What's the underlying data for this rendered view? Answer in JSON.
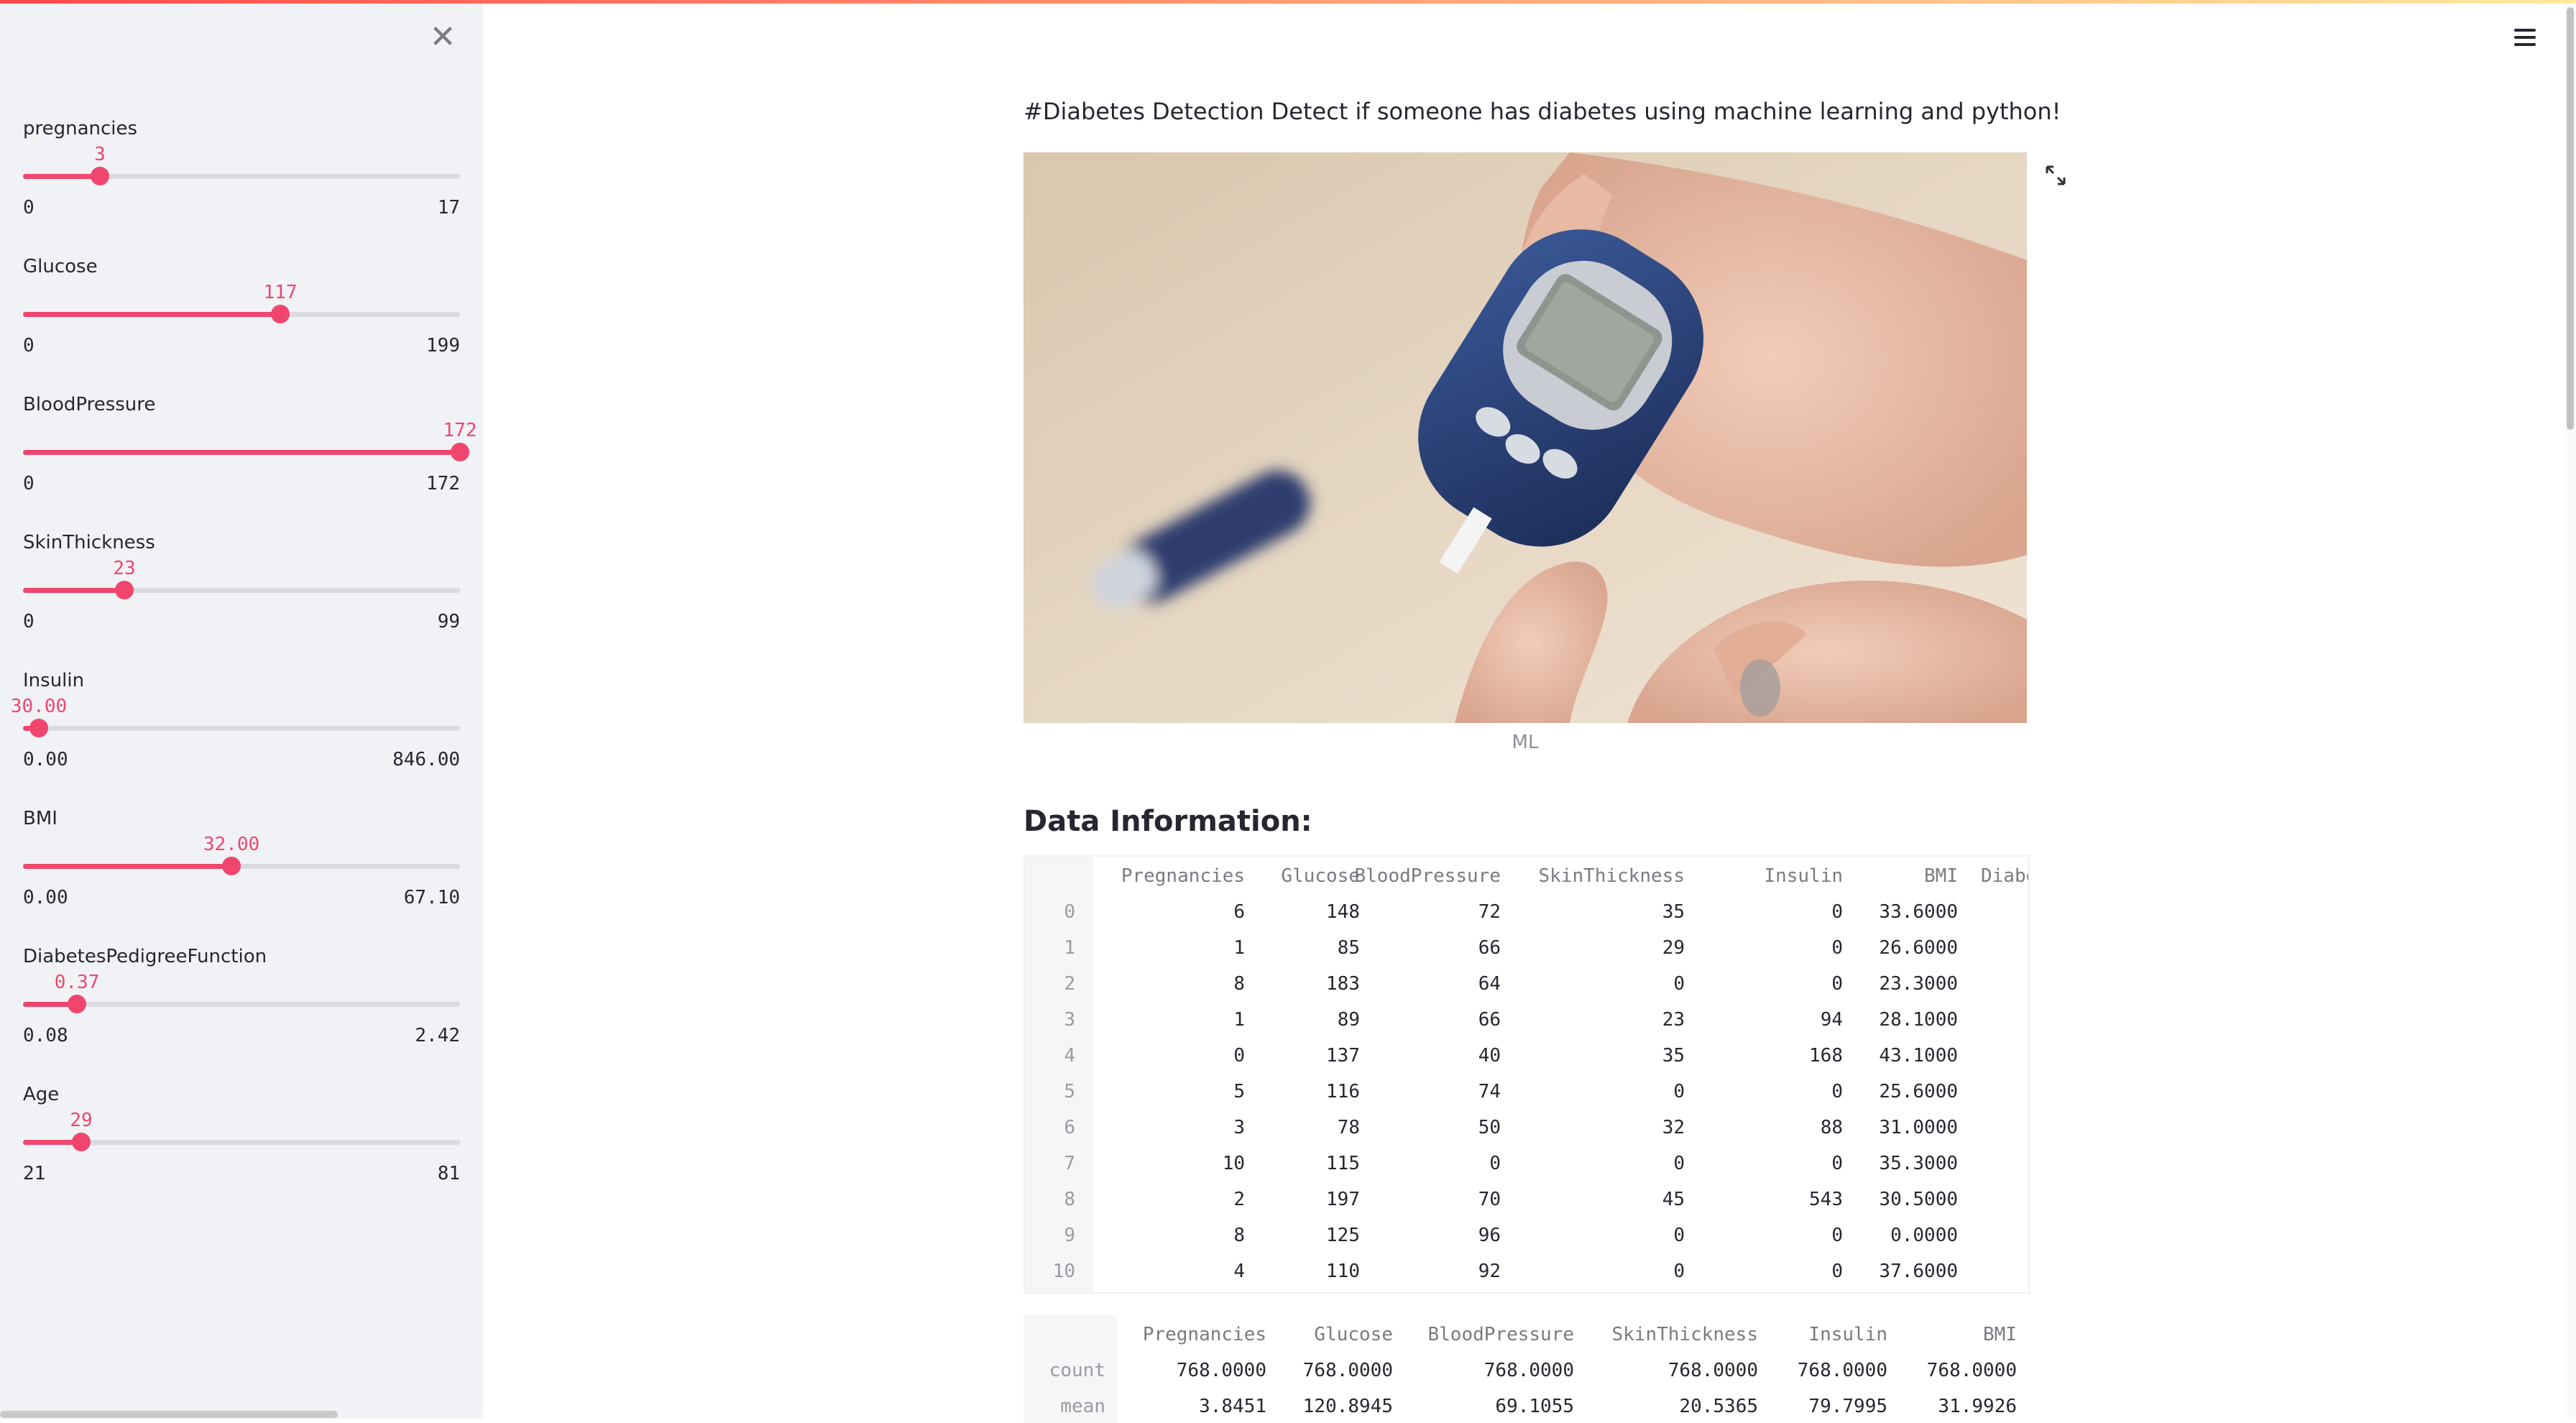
{
  "sidebar": {
    "close_icon": "close-icon",
    "sliders": [
      {
        "label": "pregnancies",
        "value": "3",
        "min": "0",
        "max": "17",
        "fraction": 0.1765
      },
      {
        "label": "Glucose",
        "value": "117",
        "min": "0",
        "max": "199",
        "fraction": 0.588
      },
      {
        "label": "BloodPressure",
        "value": "172",
        "min": "0",
        "max": "172",
        "fraction": 1.0
      },
      {
        "label": "SkinThickness",
        "value": "23",
        "min": "0",
        "max": "99",
        "fraction": 0.2323
      },
      {
        "label": "Insulin",
        "value": "30.00",
        "min": "0.00",
        "max": "846.00",
        "fraction": 0.0355
      },
      {
        "label": "BMI",
        "value": "32.00",
        "min": "0.00",
        "max": "67.10",
        "fraction": 0.4769
      },
      {
        "label": "DiabetesPedigreeFunction",
        "value": "0.37",
        "min": "0.08",
        "max": "2.42",
        "fraction": 0.1239
      },
      {
        "label": "Age",
        "value": "29",
        "min": "21",
        "max": "81",
        "fraction": 0.1333
      }
    ]
  },
  "main": {
    "title": "#Diabetes Detection Detect if someone has diabetes using machine learning and python!",
    "image_caption": "ML",
    "section_heading": "Data Information:",
    "colors": {
      "accent": "#f0466e",
      "sidebar_bg": "#f0f2f6",
      "text": "#262730"
    }
  },
  "data_table": {
    "columns": [
      "Pregnancies",
      "Glucose",
      "BloodPressure",
      "SkinThickness",
      "Insulin",
      "BMI",
      "Diabe"
    ],
    "rows": [
      [
        "0",
        "6",
        "148",
        "72",
        "35",
        "0",
        "33.6000"
      ],
      [
        "1",
        "1",
        "85",
        "66",
        "29",
        "0",
        "26.6000"
      ],
      [
        "2",
        "8",
        "183",
        "64",
        "0",
        "0",
        "23.3000"
      ],
      [
        "3",
        "1",
        "89",
        "66",
        "23",
        "94",
        "28.1000"
      ],
      [
        "4",
        "0",
        "137",
        "40",
        "35",
        "168",
        "43.1000"
      ],
      [
        "5",
        "5",
        "116",
        "74",
        "0",
        "0",
        "25.6000"
      ],
      [
        "6",
        "3",
        "78",
        "50",
        "32",
        "88",
        "31.0000"
      ],
      [
        "7",
        "10",
        "115",
        "0",
        "0",
        "0",
        "35.3000"
      ],
      [
        "8",
        "2",
        "197",
        "70",
        "45",
        "543",
        "30.5000"
      ],
      [
        "9",
        "8",
        "125",
        "96",
        "0",
        "0",
        "0.0000"
      ],
      [
        "10",
        "4",
        "110",
        "92",
        "0",
        "0",
        "37.6000"
      ]
    ]
  },
  "describe_table": {
    "columns": [
      "Pregnancies",
      "Glucose",
      "BloodPressure",
      "SkinThickness",
      "Insulin",
      "BMI"
    ],
    "rows": [
      [
        "count",
        "768.0000",
        "768.0000",
        "768.0000",
        "768.0000",
        "768.0000",
        "768.0000"
      ],
      [
        "mean",
        "3.8451",
        "120.8945",
        "69.1055",
        "20.5365",
        "79.7995",
        "31.9926"
      ]
    ]
  },
  "icons": {
    "menu": "hamburger-menu-icon",
    "expand": "expand-icon"
  }
}
